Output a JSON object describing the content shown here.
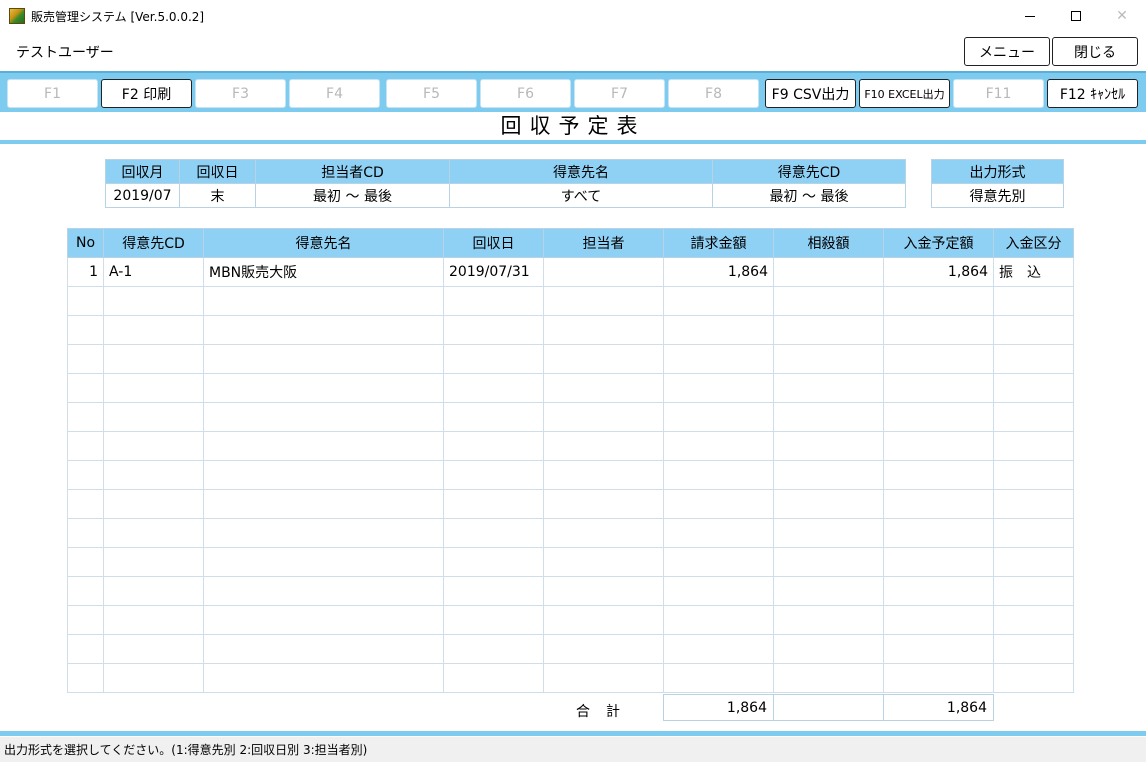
{
  "window": {
    "title": "販売管理システム [Ver.5.0.0.2]"
  },
  "header": {
    "user": "テストユーザー",
    "menu_label": "メニュー",
    "close_label": "閉じる"
  },
  "fkeys": [
    {
      "label": "F1",
      "enabled": false
    },
    {
      "label": "F2 印刷",
      "enabled": true
    },
    {
      "label": "F3",
      "enabled": false
    },
    {
      "label": "F4",
      "enabled": false
    },
    {
      "label": "F5",
      "enabled": false
    },
    {
      "label": "F6",
      "enabled": false
    },
    {
      "label": "F7",
      "enabled": false
    },
    {
      "label": "F8",
      "enabled": false
    },
    {
      "label": "F9 CSV出力",
      "enabled": true
    },
    {
      "label": "F10 EXCEL出力",
      "enabled": true
    },
    {
      "label": "F11",
      "enabled": false
    },
    {
      "label": "F12 ｷｬﾝｾﾙ",
      "enabled": true
    }
  ],
  "report_title": "回収予定表",
  "conditions": {
    "headers": [
      "回収月",
      "回収日",
      "担当者CD",
      "得意先名",
      "得意先CD"
    ],
    "values": [
      "2019/07",
      "末",
      "最初 ～ 最後",
      "すべて",
      "最初 ～ 最後"
    ]
  },
  "output_format": {
    "header": "出力形式",
    "value": "得意先別"
  },
  "grid": {
    "columns": [
      "No",
      "得意先CD",
      "得意先名",
      "回収日",
      "担当者",
      "請求金額",
      "相殺額",
      "入金予定額",
      "入金区分"
    ],
    "rows": [
      [
        "1",
        "A-1",
        "MBN販売大阪",
        "2019/07/31",
        "",
        "1,864",
        "",
        "1,864",
        "振　込"
      ]
    ],
    "empty_rows": 14
  },
  "totals": {
    "label": "合計",
    "billing": "1,864",
    "offset": "",
    "expected": "1,864"
  },
  "status": "出力形式を選択してください。(1:得意先別 2:回収日別 3:担当者別)",
  "colors": {
    "accent": "#7ecbf0",
    "header_fill": "#8fd0f5"
  }
}
